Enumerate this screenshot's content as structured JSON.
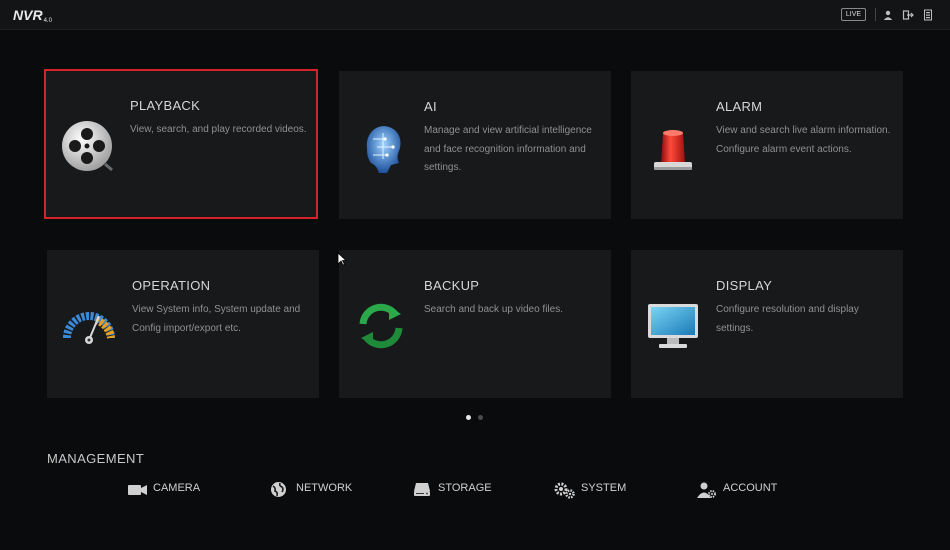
{
  "header": {
    "logo": "NVR",
    "logo_version": "4.0",
    "live_label": "LIVE",
    "icons": [
      "user-icon",
      "logout-icon",
      "menu-icon"
    ]
  },
  "tiles": [
    {
      "title": "PLAYBACK",
      "description": "View, search, and play recorded videos.",
      "icon": "film-reel-icon",
      "selected": true
    },
    {
      "title": "AI",
      "description": "Manage and view artificial intelligence and face recognition information and settings.",
      "icon": "ai-head-icon",
      "selected": false
    },
    {
      "title": "ALARM",
      "description": "View and search live alarm information. Configure alarm event actions.",
      "icon": "alarm-siren-icon",
      "selected": false
    },
    {
      "title": "OPERATION",
      "description": "View System info, System update and  Config import/export etc.",
      "icon": "gauge-icon",
      "selected": false
    },
    {
      "title": "BACKUP",
      "description": "Search and back up video files.",
      "icon": "refresh-arrows-icon",
      "selected": false
    },
    {
      "title": "DISPLAY",
      "description": "Configure resolution and display settings.",
      "icon": "monitor-icon",
      "selected": false
    }
  ],
  "pager": {
    "pages": 2,
    "current": 1
  },
  "management": {
    "title": "MANAGEMENT",
    "items": [
      {
        "label": "CAMERA",
        "icon": "camera-icon"
      },
      {
        "label": "NETWORK",
        "icon": "globe-icon"
      },
      {
        "label": "STORAGE",
        "icon": "hard-drive-icon"
      },
      {
        "label": "SYSTEM",
        "icon": "gears-icon"
      },
      {
        "label": "ACCOUNT",
        "icon": "account-icon"
      }
    ]
  },
  "colors": {
    "background": "#0a0b0c",
    "tile": "#17191b",
    "selection": "#d4242a",
    "alarm_red": "#d02020",
    "backup_green": "#2aa84a",
    "ai_blue": "#3a78c8"
  }
}
